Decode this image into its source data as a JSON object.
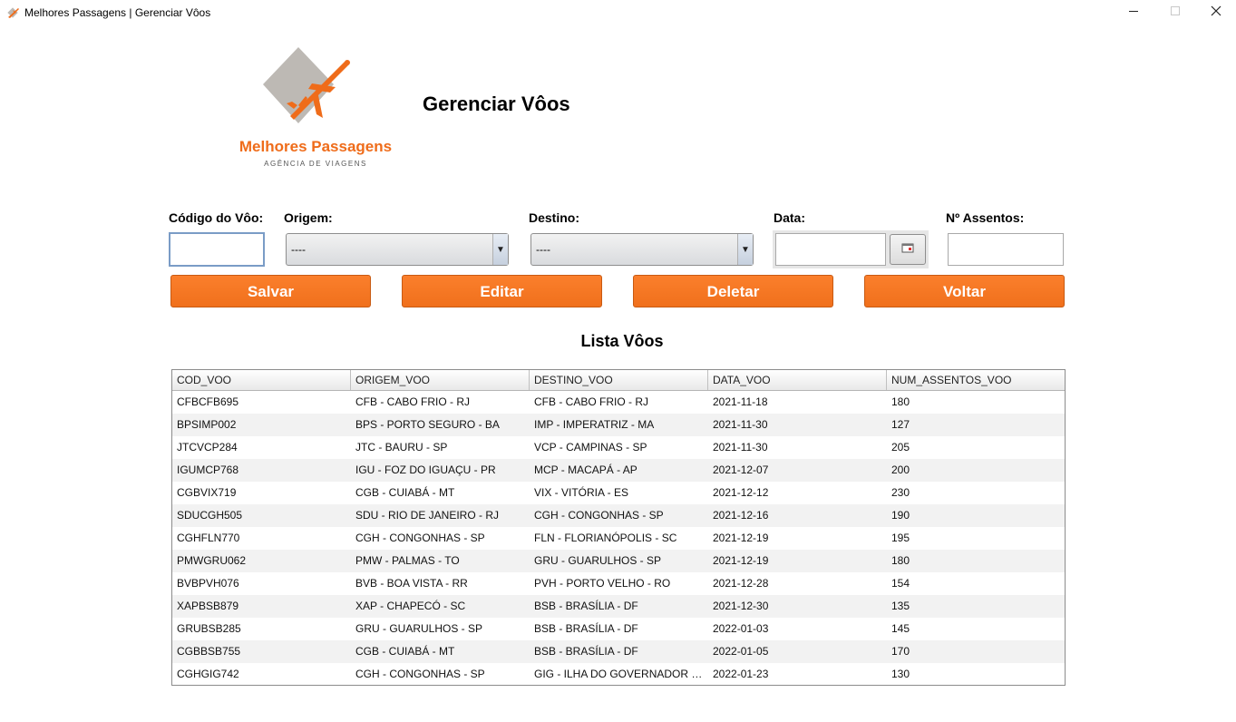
{
  "window": {
    "title": "Melhores Passagens | Gerenciar Vôos",
    "minimize_icon": "minimize-icon",
    "maximize_icon": "maximize-icon",
    "close_icon": "close-icon"
  },
  "brand": {
    "name": "Melhores Passagens",
    "tagline": "AGÊNCIA DE VIAGENS",
    "colors": {
      "accent": "#ef6c1a",
      "diamond": "#bdb9b4"
    }
  },
  "page_title": "Gerenciar Vôos",
  "form": {
    "codigo_label": "Código do Vôo:",
    "codigo_value": "",
    "origem_label": "Origem:",
    "origem_selected": "----",
    "destino_label": "Destino:",
    "destino_selected": "----",
    "data_label": "Data:",
    "data_value": "",
    "calendar_icon": "calendar-icon",
    "assentos_label": "Nº Assentos:",
    "assentos_value": ""
  },
  "actions": {
    "save_label": "Salvar",
    "edit_label": "Editar",
    "delete_label": "Deletar",
    "back_label": "Voltar",
    "color": "#f57521"
  },
  "list_title": "Lista Vôos",
  "table": {
    "columns": [
      "COD_VOO",
      "ORIGEM_VOO",
      "DESTINO_VOO",
      "DATA_VOO",
      "NUM_ASSENTOS_VOO"
    ],
    "rows": [
      [
        "CFBCFB695",
        "CFB - CABO FRIO - RJ",
        "CFB - CABO FRIO - RJ",
        "2021-11-18",
        "180"
      ],
      [
        "BPSIMP002",
        "BPS - PORTO SEGURO - BA",
        "IMP - IMPERATRIZ - MA",
        "2021-11-30",
        "127"
      ],
      [
        "JTCVCP284",
        "JTC - BAURU - SP",
        "VCP - CAMPINAS - SP",
        "2021-11-30",
        "205"
      ],
      [
        "IGUMCP768",
        "IGU - FOZ DO IGUAÇU - PR",
        "MCP - MACAPÁ - AP",
        "2021-12-07",
        "200"
      ],
      [
        "CGBVIX719",
        "CGB - CUIABÁ - MT",
        "VIX - VITÓRIA - ES",
        "2021-12-12",
        "230"
      ],
      [
        "SDUCGH505",
        "SDU - RIO DE JANEIRO - RJ",
        "CGH - CONGONHAS - SP",
        "2021-12-16",
        "190"
      ],
      [
        "CGHFLN770",
        "CGH - CONGONHAS - SP",
        "FLN - FLORIANÓPOLIS - SC",
        "2021-12-19",
        "195"
      ],
      [
        "PMWGRU062",
        "PMW - PALMAS - TO",
        "GRU - GUARULHOS - SP",
        "2021-12-19",
        "180"
      ],
      [
        "BVBPVH076",
        "BVB - BOA VISTA - RR",
        "PVH - PORTO VELHO - RO",
        "2021-12-28",
        "154"
      ],
      [
        "XAPBSB879",
        "XAP - CHAPECÓ - SC",
        "BSB - BRASÍLIA - DF",
        "2021-12-30",
        "135"
      ],
      [
        "GRUBSB285",
        "GRU - GUARULHOS - SP",
        "BSB - BRASÍLIA - DF",
        "2022-01-03",
        "145"
      ],
      [
        "CGBBSB755",
        "CGB - CUIABÁ - MT",
        "BSB - BRASÍLIA - DF",
        "2022-01-05",
        "170"
      ],
      [
        "CGHGIG742",
        "CGH - CONGONHAS - SP",
        "GIG - ILHA DO GOVERNADOR - ...",
        "2022-01-23",
        "130"
      ]
    ]
  }
}
